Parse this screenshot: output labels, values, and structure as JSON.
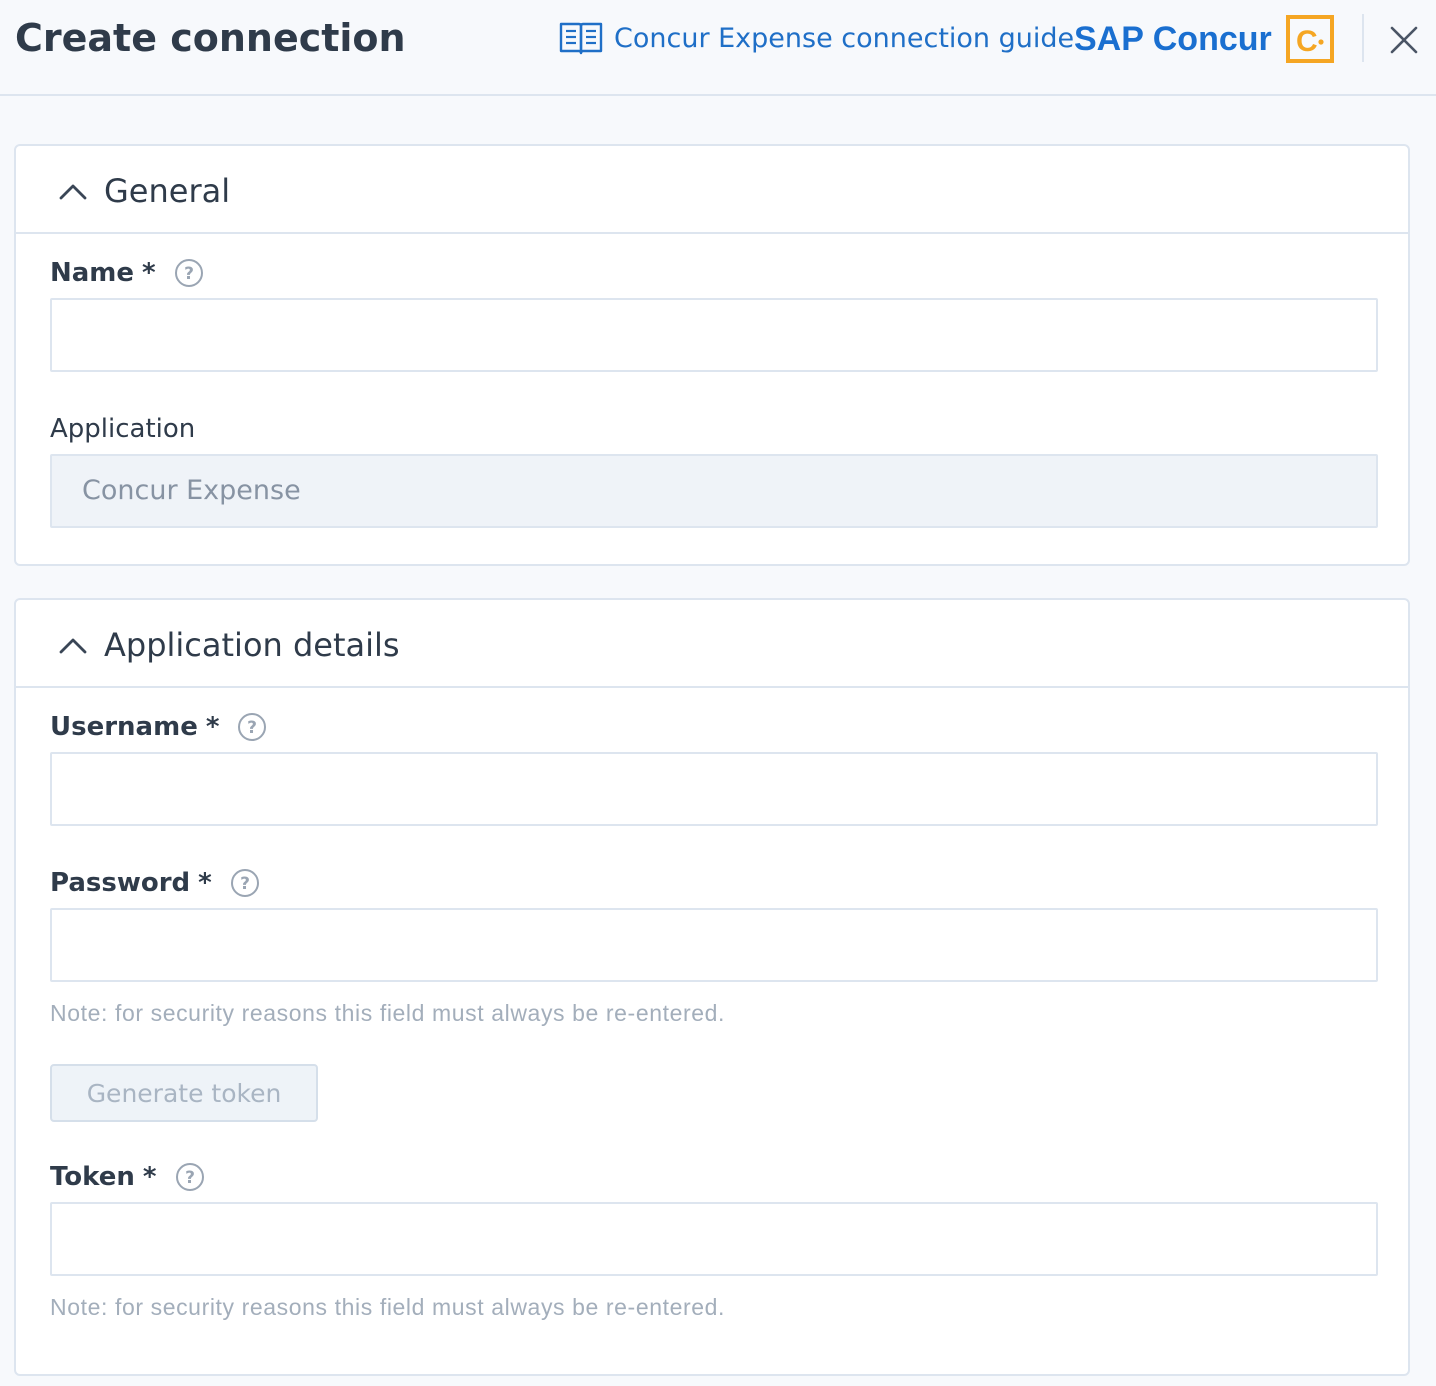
{
  "header": {
    "title": "Create connection",
    "guide_link": "Concur Expense connection guide",
    "brand": "SAP Concur",
    "brand_mark_letter": "C",
    "accent_color": "#1f6fc7",
    "brand_mark_color": "#f5a623"
  },
  "general": {
    "title": "General",
    "name": {
      "label": "Name",
      "required_mark": "*",
      "value": ""
    },
    "application": {
      "label": "Application",
      "value": "Concur Expense"
    }
  },
  "details": {
    "title": "Application details",
    "username": {
      "label": "Username",
      "required_mark": "*",
      "value": ""
    },
    "password": {
      "label": "Password",
      "required_mark": "*",
      "value": "",
      "note": "Note: for security reasons this field must always be re-entered."
    },
    "generate_token_button": "Generate token",
    "token": {
      "label": "Token",
      "required_mark": "*",
      "value": "",
      "note": "Note: for security reasons this field must always be re-entered."
    }
  },
  "icons": {
    "guide": "book-icon",
    "close": "close-icon",
    "collapse": "chevron-up-icon",
    "help": "help-icon"
  }
}
